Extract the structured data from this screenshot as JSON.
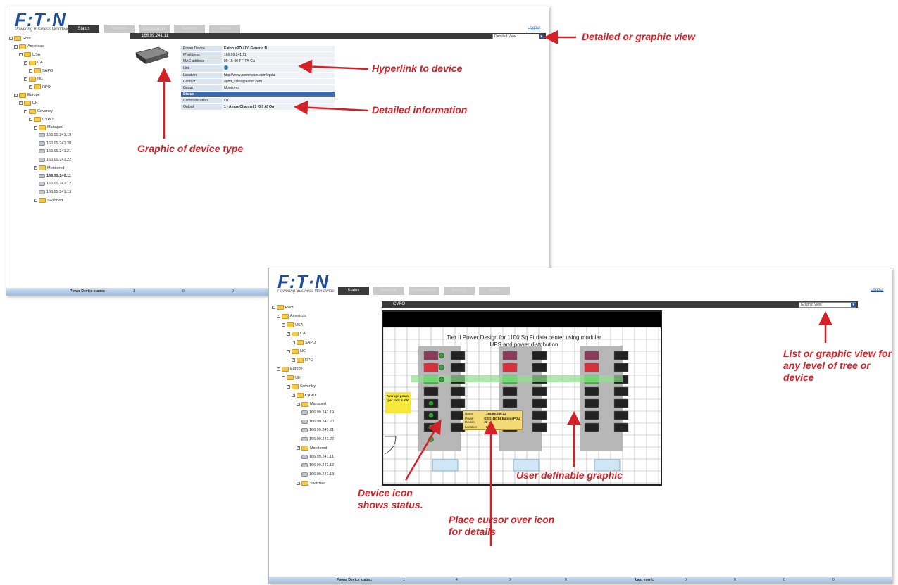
{
  "app": {
    "logo": "F:T·N",
    "tagline": "Powering Business Worldwide",
    "tabs": [
      "Status",
      "Network",
      "Maintenance",
      "Settings",
      "About"
    ],
    "logout": "Logout"
  },
  "screen1": {
    "device_title": "166.99.241.11",
    "view_select": "Detailed View",
    "tree": [
      {
        "label": "Root",
        "type": "folder",
        "level": 0
      },
      {
        "label": "Americas",
        "type": "folder",
        "level": 1
      },
      {
        "label": "USA",
        "type": "folder",
        "level": 2
      },
      {
        "label": "CA",
        "type": "folder",
        "level": 3
      },
      {
        "label": "SAPO",
        "type": "folder",
        "level": 4
      },
      {
        "label": "NC",
        "type": "folder",
        "level": 3
      },
      {
        "label": "RPO",
        "type": "folder",
        "level": 4
      },
      {
        "label": "Europe",
        "type": "folder",
        "level": 1
      },
      {
        "label": "UK",
        "type": "folder",
        "level": 2
      },
      {
        "label": "Coventry",
        "type": "folder",
        "level": 3
      },
      {
        "label": "CVPO",
        "type": "folder",
        "level": 4
      },
      {
        "label": "Managed",
        "type": "folder",
        "level": 5
      },
      {
        "label": "166.99.241.19",
        "type": "device",
        "level": 6
      },
      {
        "label": "166.99.241.20",
        "type": "device",
        "level": 6
      },
      {
        "label": "166.99.241.21",
        "type": "device",
        "level": 6
      },
      {
        "label": "166.99.241.22",
        "type": "device",
        "level": 6
      },
      {
        "label": "Monitored",
        "type": "folder",
        "level": 5
      },
      {
        "label": "166.99.240.11",
        "type": "device",
        "level": 6,
        "bold": true
      },
      {
        "label": "166.99.241.12",
        "type": "device",
        "level": 6
      },
      {
        "label": "166.99.241.13",
        "type": "device",
        "level": 6
      },
      {
        "label": "Switched",
        "type": "folder",
        "level": 5
      }
    ],
    "info": [
      {
        "k": "Power Device",
        "v": "Eaton ePDU IVI Generic B"
      },
      {
        "k": "IP address",
        "v": "166.99.241.11"
      },
      {
        "k": "MAC address",
        "v": "00-15-00-FF-FA-CA"
      },
      {
        "k": "Link",
        "v": ""
      },
      {
        "k": "Location",
        "v": "http://www.powerware.com/epdu"
      },
      {
        "k": "Contact",
        "v": "aphd_sales@eaton.com"
      },
      {
        "k": "Group",
        "v": "Monitored"
      }
    ],
    "status_header": "Status",
    "status": [
      {
        "k": "Communication",
        "v": "OK"
      },
      {
        "k": "Output",
        "v": "1 - Amps Channel 1 (0.0 A) On"
      }
    ],
    "statusbar": {
      "label": "Power Device status:",
      "items": [
        "1",
        "0",
        "0"
      ]
    }
  },
  "screen2": {
    "folder_title": "CVPO",
    "view_select": "Graphic View",
    "tree": [
      {
        "label": "Root",
        "type": "folder",
        "level": 0
      },
      {
        "label": "Americas",
        "type": "folder",
        "level": 1
      },
      {
        "label": "USA",
        "type": "folder",
        "level": 2
      },
      {
        "label": "CA",
        "type": "folder",
        "level": 3
      },
      {
        "label": "SAPO",
        "type": "folder",
        "level": 4
      },
      {
        "label": "NC",
        "type": "folder",
        "level": 3
      },
      {
        "label": "RPO",
        "type": "folder",
        "level": 4
      },
      {
        "label": "Europe",
        "type": "folder",
        "level": 1
      },
      {
        "label": "UK",
        "type": "folder",
        "level": 2
      },
      {
        "label": "Coventry",
        "type": "folder",
        "level": 3
      },
      {
        "label": "CVPO",
        "type": "folder",
        "level": 4,
        "bold": true
      },
      {
        "label": "Managed",
        "type": "folder",
        "level": 5
      },
      {
        "label": "166.99.241.19",
        "type": "device",
        "level": 6
      },
      {
        "label": "166.99.241.20",
        "type": "device",
        "level": 6
      },
      {
        "label": "166.99.241.21",
        "type": "device",
        "level": 6
      },
      {
        "label": "166.99.241.22",
        "type": "device",
        "level": 6
      },
      {
        "label": "Monitored",
        "type": "folder",
        "level": 5
      },
      {
        "label": "166.99.241.11",
        "type": "device",
        "level": 6
      },
      {
        "label": "166.99.241.12",
        "type": "device",
        "level": 6
      },
      {
        "label": "166.99.241.13",
        "type": "device",
        "level": 6
      },
      {
        "label": "Switched",
        "type": "folder",
        "level": 5
      }
    ],
    "graphic_title": "Tier II Power Design for 1100 Sq Ft data center using modular UPS and power distribution",
    "yellow_box": "Average power per rack 5 kW",
    "tooltip": [
      {
        "k": "Name",
        "v": "166.99.240.22"
      },
      {
        "k": "Power Device",
        "v": "DBG1NC14 Eaton ePDU 22"
      },
      {
        "k": "Location",
        "v": "2"
      }
    ],
    "statusbar": {
      "label": "Power Device status:",
      "items": [
        "1",
        "4",
        "0",
        "0"
      ],
      "label2": "Last event:",
      "items2": [
        "0",
        "0",
        "0",
        "0"
      ]
    }
  },
  "callouts": {
    "detailed_or_graphic": "Detailed or graphic view",
    "hyperlink": "Hyperlink to device",
    "detailed_info": "Detailed information",
    "graphic_device_type": "Graphic of device type",
    "list_or_graphic": "List or graphic view for any level of tree or device",
    "device_icon_status": "Device icon shows status.",
    "place_cursor": "Place cursor over icon for details",
    "user_definable": "User definable graphic"
  },
  "colors": {
    "accent": "#d42127",
    "eaton_blue": "#1d4f9b",
    "header_dark": "#3a3a3a"
  }
}
